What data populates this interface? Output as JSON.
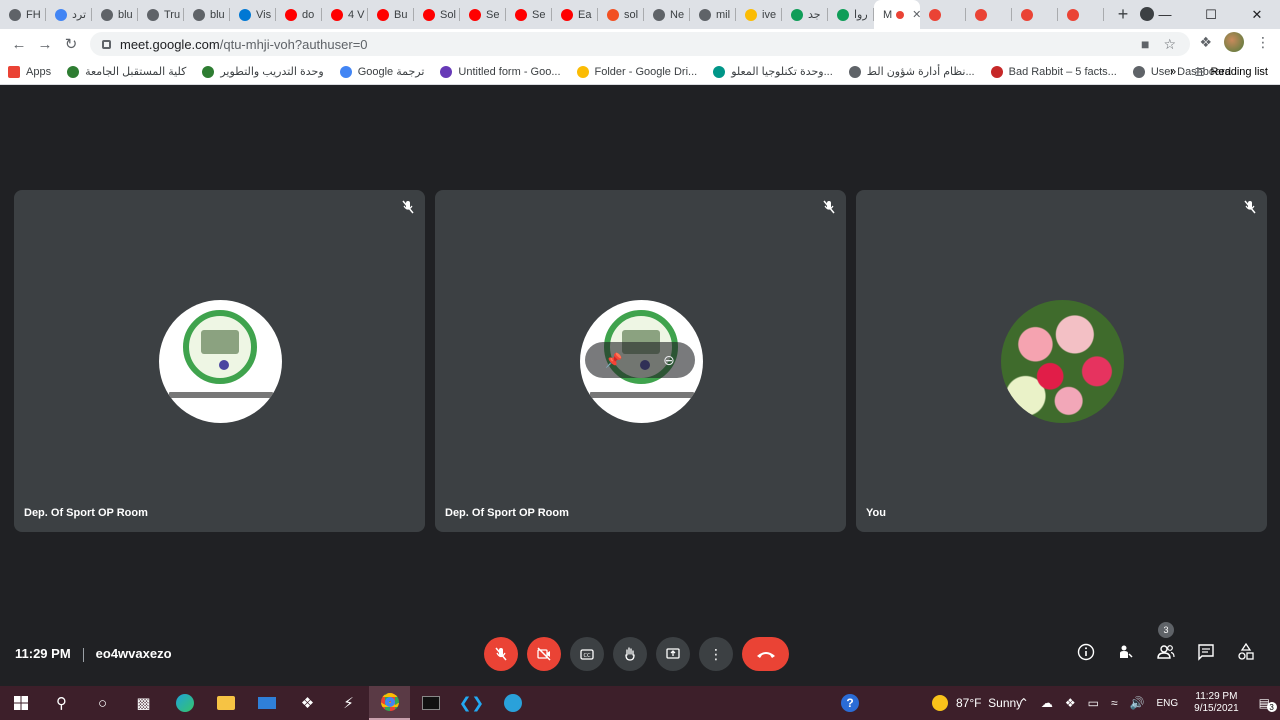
{
  "browser": {
    "tabs": [
      {
        "label": "FH",
        "color": "#5f6368"
      },
      {
        "label": "ترد",
        "color": "#4285f4"
      },
      {
        "label": "blu",
        "color": "#5f6368"
      },
      {
        "label": "Tru",
        "color": "#5f6368"
      },
      {
        "label": "blu",
        "color": "#5f6368"
      },
      {
        "label": "Vis",
        "color": "#0078d4"
      },
      {
        "label": "do",
        "color": "#ff0000"
      },
      {
        "label": "4 V",
        "color": "#ff0000"
      },
      {
        "label": "Bu",
        "color": "#ff0000"
      },
      {
        "label": "Sol",
        "color": "#ff0000"
      },
      {
        "label": "Se",
        "color": "#ff0000"
      },
      {
        "label": "Se",
        "color": "#ff0000"
      },
      {
        "label": "Ea",
        "color": "#ff0000"
      },
      {
        "label": "sol",
        "color": "#f25022"
      },
      {
        "label": "Ne",
        "color": "#5f6368"
      },
      {
        "label": "mil",
        "color": "#5f6368"
      },
      {
        "label": "ive",
        "color": "#fbbc04"
      },
      {
        "label": "جد",
        "color": "#0f9d58"
      },
      {
        "label": "روا",
        "color": "#0f9d58"
      },
      {
        "label": "",
        "color": "#ea4335"
      },
      {
        "label": "",
        "color": "#ea4335"
      },
      {
        "label": "",
        "color": "#ea4335"
      },
      {
        "label": "",
        "color": "#ea4335"
      }
    ],
    "active_tab_label": "M",
    "new_tab": "+",
    "url_host": "meet.google.com",
    "url_path": "/qtu-mhji-voh?authuser=0",
    "bookmarks": [
      {
        "label": "Apps",
        "color": "#ea4335"
      },
      {
        "label": "كلية المستقبل الجامعة",
        "color": "#2e7d32"
      },
      {
        "label": "وحدة التدريب والتطوير",
        "color": "#2e7d32"
      },
      {
        "label": "Google ترجمة",
        "color": "#4285f4"
      },
      {
        "label": "Untitled form - Goo...",
        "color": "#673ab7"
      },
      {
        "label": "Folder - Google Dri...",
        "color": "#fbbc04"
      },
      {
        "label": "وحدة تكنلوجيا المعلو...",
        "color": "#009688"
      },
      {
        "label": "نظام أدارة شؤون الط...",
        "color": "#5f6368"
      },
      {
        "label": "Bad Rabbit – 5 facts...",
        "color": "#c62828"
      },
      {
        "label": "User Dashboard",
        "color": "#5f6368"
      }
    ],
    "bookmarks_more": "»",
    "reading_list": "Reading list"
  },
  "meet": {
    "tiles": [
      {
        "name": "Dep. Of Sport OP Room",
        "avatar": "logo"
      },
      {
        "name": "Dep. Of Sport OP Room",
        "avatar": "logo"
      },
      {
        "name": "You",
        "avatar": "flowers"
      }
    ],
    "time": "11:29 PM",
    "meeting_code": "eo4wvaxezo",
    "participants_count": "3"
  },
  "taskbar": {
    "weather_temp": "87°F",
    "weather_desc": "Sunny",
    "lang": "ENG",
    "clock_time": "11:29 PM",
    "clock_date": "9/15/2021",
    "notif_count": "3",
    "accent": "#3d1f2a"
  }
}
